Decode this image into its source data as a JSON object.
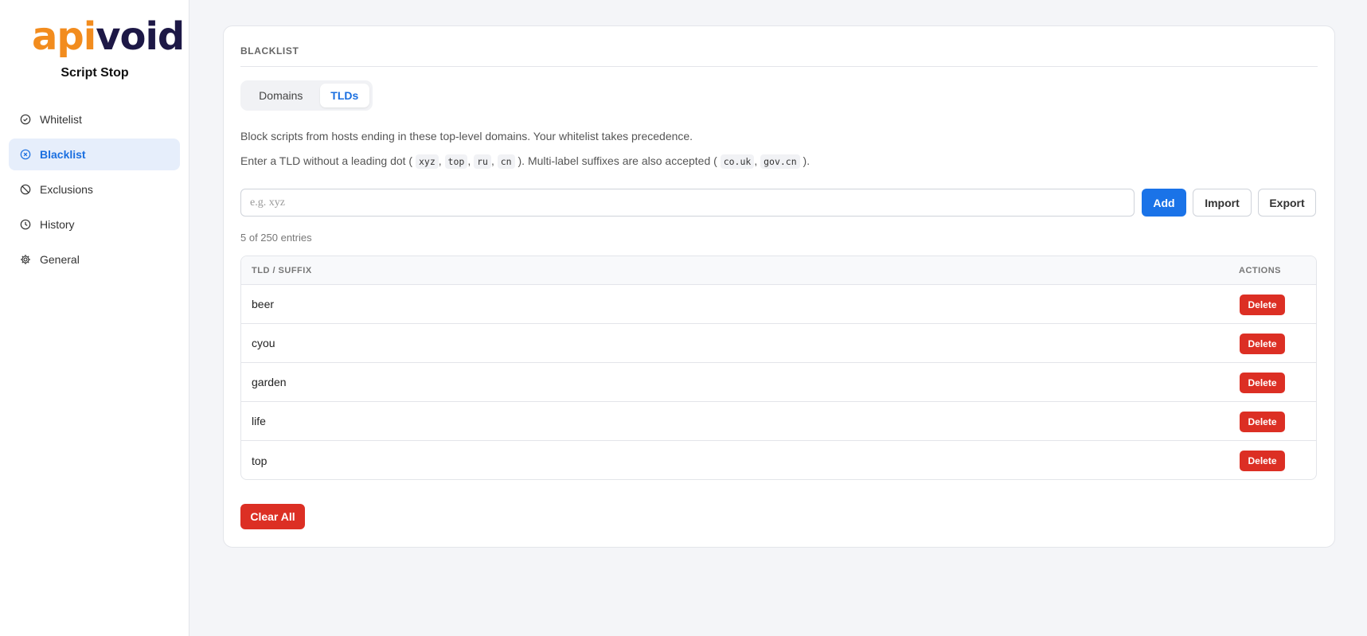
{
  "brand": {
    "logo_a": "api",
    "logo_b": "void",
    "app_name": "Script Stop"
  },
  "sidebar": {
    "items": [
      {
        "label": "Whitelist",
        "icon": "check-circle-icon"
      },
      {
        "label": "Blacklist",
        "icon": "x-circle-icon",
        "active": true
      },
      {
        "label": "Exclusions",
        "icon": "ban-icon"
      },
      {
        "label": "History",
        "icon": "clock-icon"
      },
      {
        "label": "General",
        "icon": "gear-icon"
      }
    ]
  },
  "main": {
    "title": "BLACKLIST",
    "tabs": [
      {
        "label": "Domains"
      },
      {
        "label": "TLDs",
        "active": true
      }
    ],
    "description": "Block scripts from hosts ending in these top-level domains. Your whitelist takes precedence.",
    "hint": {
      "prefix": "Enter a TLD without a leading dot (",
      "examples": [
        "xyz",
        "top",
        "ru",
        "cn"
      ],
      "middle": "). Multi-label suffixes are also accepted (",
      "suffix_examples": [
        "co.uk",
        "gov.cn"
      ],
      "end": ")."
    },
    "input": {
      "placeholder": "e.g. xyz",
      "value": ""
    },
    "buttons": {
      "add": "Add",
      "import": "Import",
      "export": "Export",
      "clear_all": "Clear All"
    },
    "entry_count": "5 of 250 entries",
    "table": {
      "columns": [
        "TLD / SUFFIX",
        "ACTIONS"
      ],
      "rows": [
        {
          "tld": "beer",
          "action": "Delete"
        },
        {
          "tld": "cyou",
          "action": "Delete"
        },
        {
          "tld": "garden",
          "action": "Delete"
        },
        {
          "tld": "life",
          "action": "Delete"
        },
        {
          "tld": "top",
          "action": "Delete"
        }
      ]
    }
  },
  "colors": {
    "accent": "#1a73e8",
    "danger": "#dc2f24",
    "logo_orange": "#f28c1e",
    "logo_navy": "#1d1846"
  }
}
